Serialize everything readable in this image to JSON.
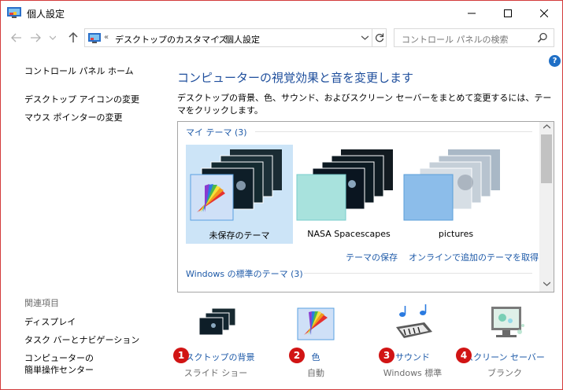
{
  "window": {
    "title": "個人設定",
    "min_label": "─",
    "max_label": "☐",
    "close_label": "✕"
  },
  "address": {
    "overflow": "«",
    "crumbs": [
      "デスクトップのカスタマイズ",
      "個人設定"
    ],
    "separator": "›",
    "search_placeholder": "コントロール パネルの検索"
  },
  "left": {
    "home": "コントロール パネル ホーム",
    "links": [
      "デスクトップ アイコンの変更",
      "マウス ポインターの変更"
    ],
    "related_title": "関連項目",
    "related": [
      "ディスプレイ",
      "タスク バーとナビゲーション",
      "コンピューターの",
      "簡単操作センター"
    ]
  },
  "main": {
    "heading": "コンピューターの視覚効果と音を変更します",
    "description": "デスクトップの背景、色、サウンド、およびスクリーン セーバーをまとめて変更するには、テーマをクリックします。",
    "my_themes_label": "マイ テーマ (3)",
    "themes": [
      {
        "name": "未保存のテーマ"
      },
      {
        "name": "NASA Spacescapes"
      },
      {
        "name": "pictures"
      }
    ],
    "save_theme": "テーマの保存",
    "get_more": "オンラインで追加のテーマを取得",
    "windows_themes_label": "Windows の標準のテーマ (3)"
  },
  "bottom": [
    {
      "number": "1",
      "label": "デスクトップの背景",
      "sub": "スライド ショー",
      "icon": "desktop-background-icon"
    },
    {
      "number": "2",
      "label": "色",
      "sub": "自動",
      "icon": "color-icon"
    },
    {
      "number": "3",
      "label": "サウンド",
      "sub": "Windows 標準",
      "icon": "sound-icon"
    },
    {
      "number": "4",
      "label": "スクリーン セーバー",
      "sub": "ブランク",
      "icon": "screensaver-icon"
    }
  ],
  "colors": {
    "accent": "#1e5aa8",
    "heading": "#1e4e9c",
    "badge": "#d11414",
    "selected": "#cce4f7",
    "border": "#d33b3b"
  }
}
